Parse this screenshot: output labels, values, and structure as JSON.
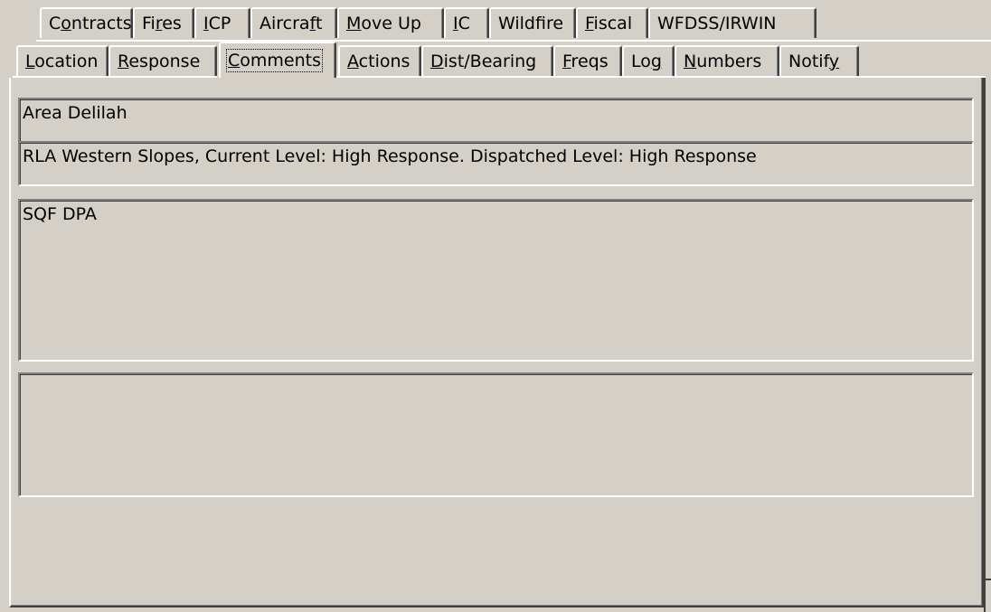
{
  "tabs_row1": [
    {
      "pre": "C",
      "ul": "o",
      "post": "ntracts"
    },
    {
      "pre": "Fi",
      "ul": "r",
      "post": "es"
    },
    {
      "pre": "",
      "ul": "I",
      "post": "CP"
    },
    {
      "pre": "Aircra",
      "ul": "f",
      "post": "t"
    },
    {
      "pre": "",
      "ul": "M",
      "post": "ove Up"
    },
    {
      "pre": "",
      "ul": "I",
      "post": "C"
    },
    {
      "pre": "Wildfire",
      "ul": "",
      "post": ""
    },
    {
      "pre": "",
      "ul": "F",
      "post": "iscal"
    },
    {
      "pre": "WFDSS/IRWIN",
      "ul": "",
      "post": ""
    }
  ],
  "tabs_row2": [
    {
      "pre": "",
      "ul": "L",
      "post": "ocation"
    },
    {
      "pre": "",
      "ul": "R",
      "post": "esponse"
    },
    {
      "pre": "",
      "ul": "C",
      "post": "omments"
    },
    {
      "pre": "",
      "ul": "A",
      "post": "ctions"
    },
    {
      "pre": "",
      "ul": "D",
      "post": "ist/Bearing"
    },
    {
      "pre": "",
      "ul": "F",
      "post": "reqs"
    },
    {
      "pre": "Lo",
      "ul": "g",
      "post": ""
    },
    {
      "pre": "",
      "ul": "N",
      "post": "umbers"
    },
    {
      "pre": "Notif",
      "ul": "y",
      "post": ""
    }
  ],
  "active_tab": "Comments",
  "fields": {
    "area": "Area Delilah",
    "rla": "RLA Western Slopes, Current Level: High Response. Dispatched Level: High Response",
    "comments": "SQF DPA",
    "notes": ""
  }
}
